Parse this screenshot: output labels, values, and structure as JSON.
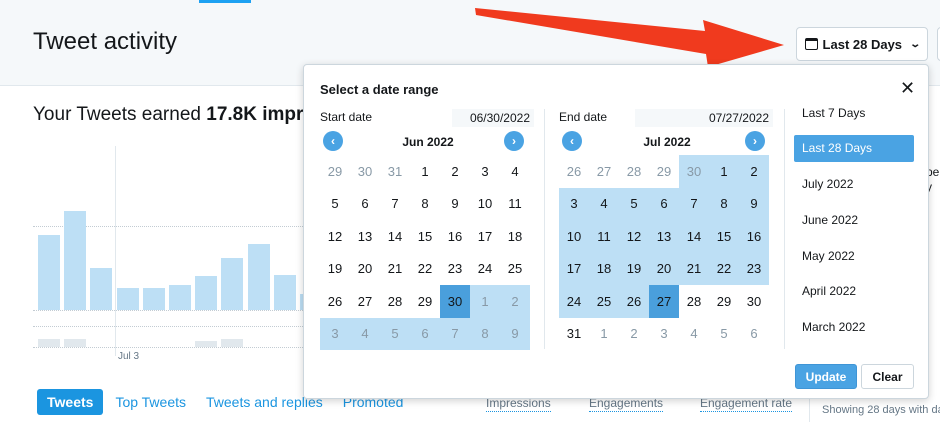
{
  "header": {
    "title": "Tweet activity",
    "range_button": "Last 28 Days",
    "range_icon": "calendar-icon",
    "chevron_icon": "chevron-down-icon"
  },
  "summary": {
    "prefix": "Your Tweets earned ",
    "value": "17.8K impr"
  },
  "chart": {
    "x_tick": "Jul 3",
    "impressions_levels": [
      0.58,
      0.76,
      0.32,
      0.17,
      0.17,
      0.19,
      0.26,
      0.4,
      0.51,
      0.27,
      0.12
    ],
    "engagement_levels": [
      0.25,
      0.25,
      0,
      0,
      0,
      0,
      0.2,
      0.25,
      0,
      0,
      0
    ]
  },
  "tabs": [
    "Tweets",
    "Top Tweets",
    "Tweets and replies",
    "Promoted"
  ],
  "metrics": [
    "Impressions",
    "Engagements",
    "Engagement rate"
  ],
  "side_note": "Showing 28 days with da",
  "right_fragments": [
    "pe",
    "y"
  ],
  "popover": {
    "title": "Select a date range",
    "close_icon": "close-icon",
    "start": {
      "label": "Start date",
      "value": "06/30/2022",
      "month": "Jun 2022",
      "days": [
        {
          "d": "29",
          "s": "muted"
        },
        {
          "d": "30",
          "s": "muted"
        },
        {
          "d": "31",
          "s": "muted"
        },
        {
          "d": "1",
          "s": ""
        },
        {
          "d": "2",
          "s": ""
        },
        {
          "d": "3",
          "s": ""
        },
        {
          "d": "4",
          "s": ""
        },
        {
          "d": "5",
          "s": ""
        },
        {
          "d": "6",
          "s": ""
        },
        {
          "d": "7",
          "s": ""
        },
        {
          "d": "8",
          "s": ""
        },
        {
          "d": "9",
          "s": ""
        },
        {
          "d": "10",
          "s": ""
        },
        {
          "d": "11",
          "s": ""
        },
        {
          "d": "12",
          "s": ""
        },
        {
          "d": "13",
          "s": ""
        },
        {
          "d": "14",
          "s": ""
        },
        {
          "d": "15",
          "s": ""
        },
        {
          "d": "16",
          "s": ""
        },
        {
          "d": "17",
          "s": ""
        },
        {
          "d": "18",
          "s": ""
        },
        {
          "d": "19",
          "s": ""
        },
        {
          "d": "20",
          "s": ""
        },
        {
          "d": "21",
          "s": ""
        },
        {
          "d": "22",
          "s": ""
        },
        {
          "d": "23",
          "s": ""
        },
        {
          "d": "24",
          "s": ""
        },
        {
          "d": "25",
          "s": ""
        },
        {
          "d": "26",
          "s": ""
        },
        {
          "d": "27",
          "s": ""
        },
        {
          "d": "28",
          "s": ""
        },
        {
          "d": "29",
          "s": ""
        },
        {
          "d": "30",
          "s": "sel"
        },
        {
          "d": "1",
          "s": "muted inr"
        },
        {
          "d": "2",
          "s": "muted inr"
        },
        {
          "d": "3",
          "s": "muted inr"
        },
        {
          "d": "4",
          "s": "muted inr"
        },
        {
          "d": "5",
          "s": "muted inr"
        },
        {
          "d": "6",
          "s": "muted inr"
        },
        {
          "d": "7",
          "s": "muted inr"
        },
        {
          "d": "8",
          "s": "muted inr"
        },
        {
          "d": "9",
          "s": "muted inr"
        }
      ]
    },
    "end": {
      "label": "End date",
      "value": "07/27/2022",
      "month": "Jul 2022",
      "days": [
        {
          "d": "26",
          "s": "muted"
        },
        {
          "d": "27",
          "s": "muted"
        },
        {
          "d": "28",
          "s": "muted"
        },
        {
          "d": "29",
          "s": "muted"
        },
        {
          "d": "30",
          "s": "muted inr"
        },
        {
          "d": "1",
          "s": "inr"
        },
        {
          "d": "2",
          "s": "inr"
        },
        {
          "d": "3",
          "s": "inr"
        },
        {
          "d": "4",
          "s": "inr"
        },
        {
          "d": "5",
          "s": "inr"
        },
        {
          "d": "6",
          "s": "inr"
        },
        {
          "d": "7",
          "s": "inr"
        },
        {
          "d": "8",
          "s": "inr"
        },
        {
          "d": "9",
          "s": "inr"
        },
        {
          "d": "10",
          "s": "inr"
        },
        {
          "d": "11",
          "s": "inr"
        },
        {
          "d": "12",
          "s": "inr"
        },
        {
          "d": "13",
          "s": "inr"
        },
        {
          "d": "14",
          "s": "inr"
        },
        {
          "d": "15",
          "s": "inr"
        },
        {
          "d": "16",
          "s": "inr"
        },
        {
          "d": "17",
          "s": "inr"
        },
        {
          "d": "18",
          "s": "inr"
        },
        {
          "d": "19",
          "s": "inr"
        },
        {
          "d": "20",
          "s": "inr"
        },
        {
          "d": "21",
          "s": "inr"
        },
        {
          "d": "22",
          "s": "inr"
        },
        {
          "d": "23",
          "s": "inr"
        },
        {
          "d": "24",
          "s": "inr"
        },
        {
          "d": "25",
          "s": "inr"
        },
        {
          "d": "26",
          "s": "inr"
        },
        {
          "d": "27",
          "s": "sel"
        },
        {
          "d": "28",
          "s": ""
        },
        {
          "d": "29",
          "s": ""
        },
        {
          "d": "30",
          "s": ""
        },
        {
          "d": "31",
          "s": ""
        },
        {
          "d": "1",
          "s": "muted"
        },
        {
          "d": "2",
          "s": "muted"
        },
        {
          "d": "3",
          "s": "muted"
        },
        {
          "d": "4",
          "s": "muted"
        },
        {
          "d": "5",
          "s": "muted"
        },
        {
          "d": "6",
          "s": "muted"
        }
      ]
    },
    "presets": [
      "Last 7 Days",
      "Last 28 Days",
      "July 2022",
      "June 2022",
      "May 2022",
      "April 2022",
      "March 2022"
    ],
    "active_preset": "Last 28 Days",
    "update_label": "Update",
    "clear_label": "Clear"
  },
  "colors": {
    "accent": "#4aa3e3",
    "range_fill": "#bddff5",
    "selected_day": "#4a9fdc",
    "arrow": "#f03a1e"
  }
}
